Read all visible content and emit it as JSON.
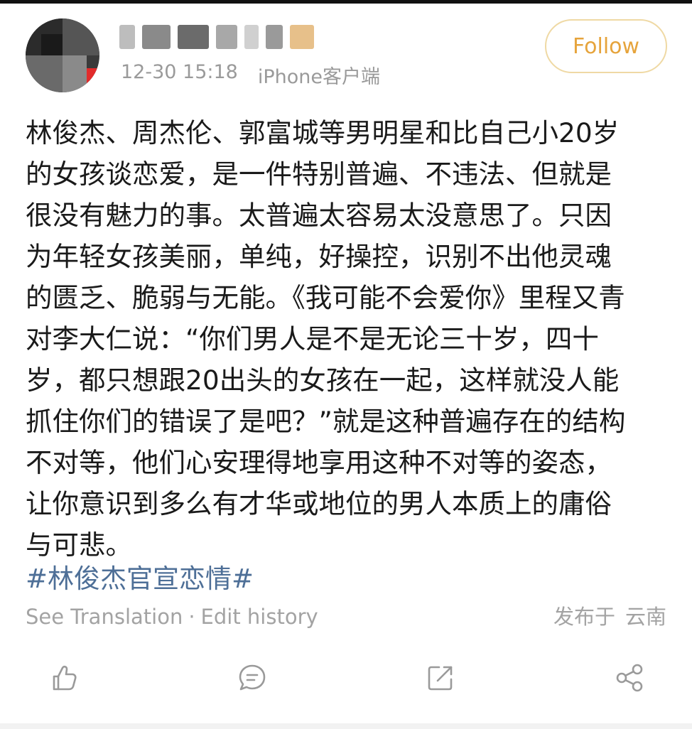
{
  "author": {
    "name": "*** **",
    "timestamp": "12-30 15:18",
    "client": "iPhone客户端",
    "follow_label": "Follow"
  },
  "post": {
    "lines": [
      "林俊杰、周杰伦、郭富城等男明星和比自己小20岁",
      "的女孩谈恋爱，是一件特别普遍、不违法、但就是",
      "很没有魅力的事。太普遍太容易太没意思了。只因",
      "为年轻女孩美丽，单纯，好操控，识别不出他灵魂",
      "的匮乏、脆弱与无能。《我可能不会爱你》里程又青",
      "对李大仁说：“你们男人是不是无论三十岁，四十",
      "岁，都只想跟20出头的女孩在一起，这样就没人能",
      "抓住你们的错误了是吧？”就是这种普遍存在的结构",
      "不对等，他们心安理得地享用这种不对等的姿态，",
      "让你意识到多么有才华或地位的男人本质上的庸俗",
      "与可悲。"
    ],
    "hashtag": "#林俊杰官宣恋情#"
  },
  "footer": {
    "see_translation": "See Translation",
    "separator": "·",
    "edit_history": "Edit history",
    "published_prefix": "发布于",
    "location": "云南"
  },
  "actions": {
    "like_icon": "thumbs-up-icon",
    "comment_icon": "comment-icon",
    "repost_icon": "repost-icon",
    "share_icon": "share-icon"
  },
  "colors": {
    "accent_follow": "#e6a43c",
    "hashtag": "#4e6f97",
    "meta": "#9a9a9a",
    "body_text": "#1a1a1a"
  }
}
